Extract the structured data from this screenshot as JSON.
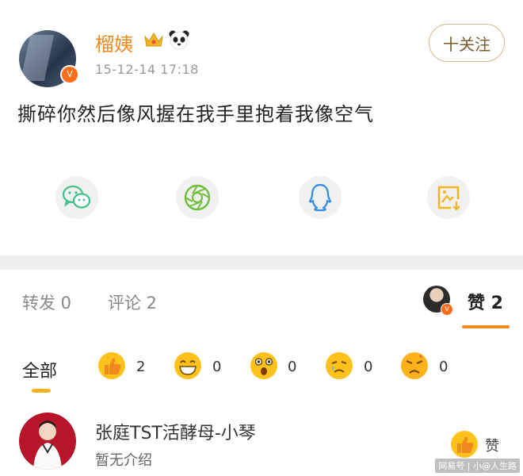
{
  "post": {
    "username": "榴姨",
    "timestamp": "15-12-14 17:18",
    "follow_label": "十关注",
    "content": "撕碎你然后像风握在我手里抱着我像空气",
    "verified_badge": "V"
  },
  "share": {
    "icons": [
      "wechat-icon",
      "moments-icon",
      "qq-icon",
      "save-image-icon"
    ]
  },
  "tabs": {
    "repost": "转发 0",
    "comment": "评论 2",
    "like": "赞 2",
    "liker_badge": "V"
  },
  "reactions": {
    "all_label": "全部",
    "items": [
      {
        "name": "thumbs-up",
        "count": "2"
      },
      {
        "name": "grin",
        "count": "0"
      },
      {
        "name": "surprised",
        "count": "0"
      },
      {
        "name": "sad",
        "count": "0"
      },
      {
        "name": "angry",
        "count": "0"
      }
    ]
  },
  "liker": {
    "name": "张庭TST活酵母-小琴",
    "intro": "暂无介绍",
    "like_label": "赞"
  },
  "watermark": "网易号 | 小@人生路",
  "colors": {
    "accent": "#f08a1e",
    "follow_border": "#d5b78a",
    "wechat": "#3ec18b",
    "moments": "#6fbf3a",
    "qq": "#2f8de4",
    "save": "#f5b41f",
    "emoji": "#ffc21c"
  }
}
